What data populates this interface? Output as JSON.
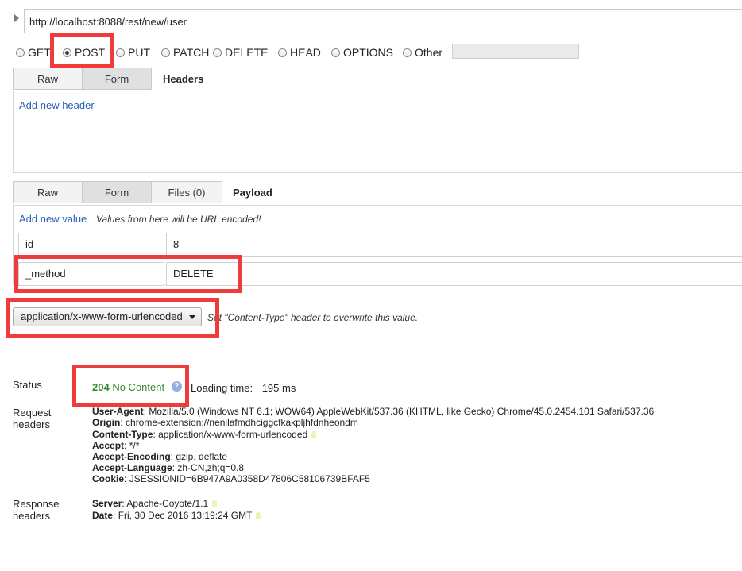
{
  "url": "http://localhost:8088/rest/new/user",
  "methods": [
    "GET",
    "POST",
    "PUT",
    "PATCH",
    "DELETE",
    "HEAD",
    "OPTIONS",
    "Other"
  ],
  "selected_method": "POST",
  "headers_section": {
    "tabs": [
      "Raw",
      "Form"
    ],
    "active_tab": "Form",
    "title": "Headers",
    "add_link": "Add new header"
  },
  "payload_section": {
    "tabs": [
      "Raw",
      "Form",
      "Files (0)"
    ],
    "active_tab": "Form",
    "title": "Payload",
    "add_link": "Add new value",
    "note": "Values from here will be URL encoded!",
    "rows": [
      {
        "key": "id",
        "value": "8"
      },
      {
        "key": "_method",
        "value": "DELETE"
      }
    ]
  },
  "content_type": {
    "selected": "application/x-www-form-urlencoded",
    "hint": "Set \"Content-Type\" header to overwrite this value."
  },
  "response": {
    "status_label": "Status",
    "status_code": "204",
    "status_text": "No Content",
    "loading_label": "Loading time:",
    "loading_value": "195 ms",
    "request_headers_label_1": "Request",
    "request_headers_label_2": "headers",
    "request_headers": [
      {
        "name": "User-Agent",
        "value": "Mozilla/5.0 (Windows NT 6.1; WOW64) AppleWebKit/537.36 (KHTML, like Gecko) Chrome/45.0.2454.101 Safari/537.36",
        "bulb": false
      },
      {
        "name": "Origin",
        "value": "chrome-extension://nenilafmdhciggcfkakpljhfdnheondm",
        "bulb": false
      },
      {
        "name": "Content-Type",
        "value": "application/x-www-form-urlencoded",
        "bulb": true
      },
      {
        "name": "Accept",
        "value": "*/*",
        "bulb": false
      },
      {
        "name": "Accept-Encoding",
        "value": "gzip, deflate",
        "bulb": false
      },
      {
        "name": "Accept-Language",
        "value": "zh-CN,zh;q=0.8",
        "bulb": false
      },
      {
        "name": "Cookie",
        "value": "JSESSIONID=6B947A9A0358D47806C58106739BFAF5",
        "bulb": false
      }
    ],
    "response_headers_label_1": "Response",
    "response_headers_label_2": "headers",
    "response_headers": [
      {
        "name": "Server",
        "value": "Apache-Coyote/1.1",
        "bulb": true
      },
      {
        "name": "Date",
        "value": "Fri, 30 Dec 2016 13:19:24 GMT",
        "bulb": true
      }
    ]
  },
  "colors": {
    "highlight_box": "#ef3b3b",
    "status_ok": "#2e8b2e",
    "link": "#2a62b8"
  }
}
